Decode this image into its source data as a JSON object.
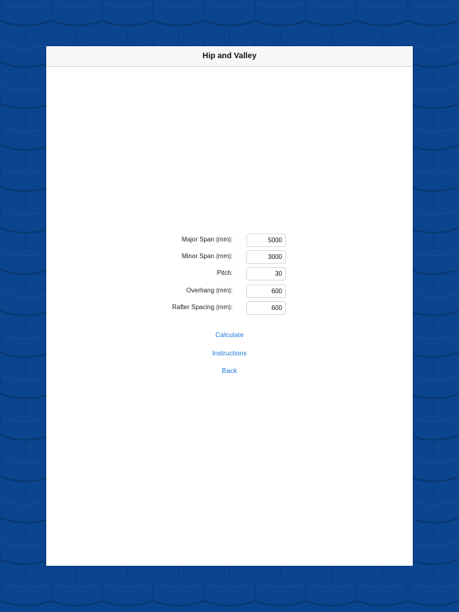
{
  "navigation": {
    "title": "Hip and Valley"
  },
  "form": {
    "fields": [
      {
        "label": "Major Span (mm):",
        "value": "5000"
      },
      {
        "label": "Minor Span (mm):",
        "value": "3000"
      },
      {
        "label": "Pitch:",
        "value": "30"
      },
      {
        "label": "Overhang (mm):",
        "value": "600"
      },
      {
        "label": "Rafter Spacing (mm):",
        "value": "600"
      }
    ]
  },
  "actions": {
    "calculate": "Calculate",
    "instructions": "Instructions",
    "back": "Back"
  },
  "colors": {
    "background": "#0b4590",
    "link": "#1a7ad8"
  }
}
